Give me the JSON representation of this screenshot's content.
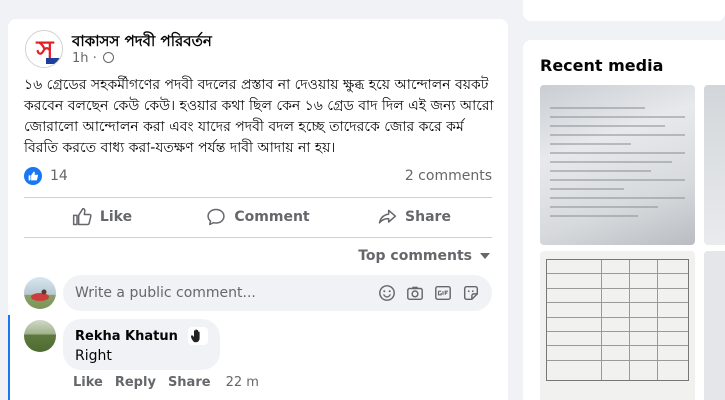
{
  "post": {
    "page_name": "বাকাসস পদবী পরিবর্তন",
    "time": "1h",
    "avatar_letter": "স",
    "text": "১৬ গ্রেডের সহকর্মীগণের পদবী বদলের প্রস্তাব না দেওয়ায় ক্ষুব্ধ হয়ে আন্দোলন বয়কট করবেন বলছেন কেউ কেউ। হওয়ার কথা ছিল কেন ১৬ গ্রেড বাদ দিল এই জন্য আরো জোরালো আন্দোলন করা এবং যাদের পদবী বদল হচ্ছে তাদেরকে জোর করে কর্ম বিরতি করতে বাধ্য করা-যতক্ষণ পর্যন্ত দাবী আদায় না হয়।",
    "reaction_count": "14",
    "comments_count": "2 comments"
  },
  "actions": {
    "like": "Like",
    "comment": "Comment",
    "share": "Share"
  },
  "sort": {
    "label": "Top comments"
  },
  "composer": {
    "placeholder": "Write a public comment..."
  },
  "comments": [
    {
      "author": "Rekha Khatun",
      "text": "Right",
      "like": "Like",
      "reply": "Reply",
      "share": "Share",
      "time": "22 m"
    }
  ],
  "sidebar": {
    "media_title": "Recent media"
  },
  "colors": {
    "accent": "#1877f2",
    "page_bg": "#f0f2f5",
    "secondary_text": "#65676b",
    "avatar_red": "#e41e26"
  },
  "icons": [
    "globe-icon",
    "like-reaction-icon",
    "thumbs-up-icon",
    "comment-icon",
    "share-icon",
    "chevron-down-icon",
    "emoji-icon",
    "camera-icon",
    "gif-icon",
    "sticker-icon",
    "waving-hand-icon"
  ]
}
